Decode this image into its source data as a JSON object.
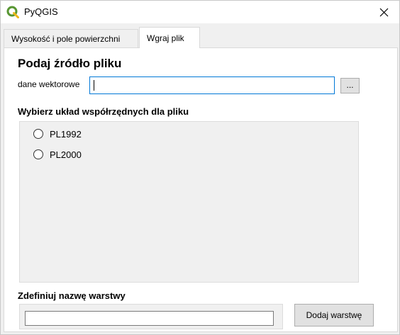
{
  "window": {
    "title": "PyQGIS",
    "icon": "qgis-logo-icon",
    "close_icon": "close-icon"
  },
  "tabs": [
    {
      "label": "Wysokość i pole powierzchni",
      "active": false
    },
    {
      "label": "Wgraj plik",
      "active": true
    }
  ],
  "source": {
    "heading": "Podaj źródło pliku",
    "vector_label": "dane wektorowe",
    "vector_value": "",
    "browse_label": "..."
  },
  "crs": {
    "heading": "Wybierz układ współrzędnych dla pliku",
    "options": [
      {
        "label": "PL1992",
        "checked": false
      },
      {
        "label": "PL2000",
        "checked": false
      }
    ]
  },
  "layer": {
    "heading": "Zdefiniuj nazwę warstwy",
    "name_value": "",
    "add_label": "Dodaj warstwę"
  },
  "colors": {
    "qgis_green": "#589632",
    "qgis_yellow": "#eeb718",
    "focus_blue": "#0078d7"
  }
}
